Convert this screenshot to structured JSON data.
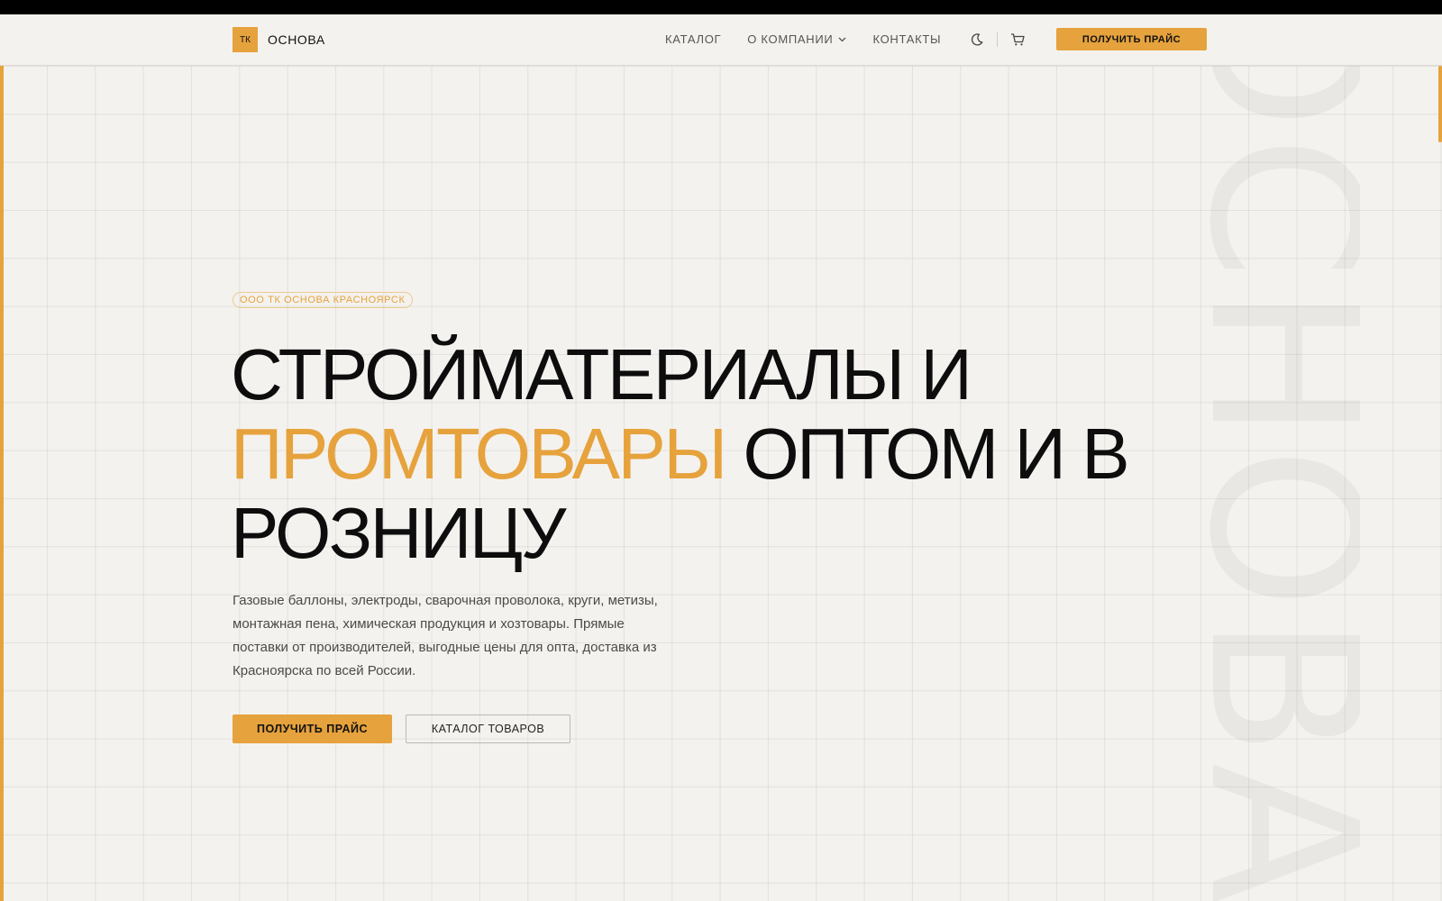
{
  "brand": {
    "mark": "ТК",
    "name": "ОСНОВА",
    "accent_color": "#e6a23c"
  },
  "nav": {
    "items": [
      {
        "label": "КАТАЛОГ"
      },
      {
        "label": "О КОМПАНИИ",
        "icon": "chevron-down-icon"
      },
      {
        "label": "КОНТАКТЫ"
      }
    ]
  },
  "header": {
    "theme_icon": "moon-icon",
    "cart_icon": "cart-icon",
    "cta_label": "ПОЛУЧИТЬ ПРАЙС"
  },
  "hero": {
    "badge": "ООО ТК ОСНОВА КРАСНОЯРСК",
    "title_line1": "СТРОЙМАТЕРИАЛЫ И",
    "title_accent": "ПРОМТОВАРЫ",
    "title_rest": "ОПТОМ И В РОЗНИЦУ",
    "lead": "Газовые баллоны, электроды, сварочная проволока, круги, метизы, монтажная пена, химическая продукция и хозтовары. Прямые поставки от производителей, выгодные цены для опта, доставка из Красноярска по всей России.",
    "primary_cta": "ПОЛУЧИТЬ ПРАЙС",
    "secondary_cta": "КАТАЛОГ ТОВАРОВ",
    "watermark": "ОСНОВА"
  }
}
